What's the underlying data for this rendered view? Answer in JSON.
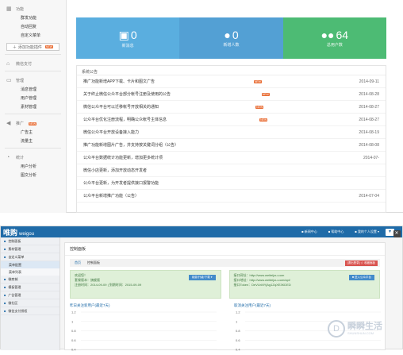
{
  "top_sidebar": {
    "sections": [
      {
        "icon": "grid-icon",
        "label": "功能",
        "items": [
          "群发功能",
          "自动回复",
          "自定义菜单"
        ]
      },
      {
        "add_label": "添加功能插件",
        "badge": "NEW"
      },
      {
        "icon": "store-icon",
        "label": "微信支付",
        "items": []
      },
      {
        "icon": "inbox-icon",
        "label": "管理",
        "items": [
          "消息管理",
          "用户管理",
          "素材管理"
        ]
      },
      {
        "icon": "megaphone-icon",
        "label": "推广",
        "badge": "NEW",
        "items": [
          "广告主",
          "流量主"
        ]
      },
      {
        "icon": "chart-icon",
        "label": "统计",
        "items": [
          "用户分析",
          "图文分析"
        ]
      }
    ]
  },
  "stats": [
    {
      "icon": "message-icon",
      "value": "0",
      "label": "新消息",
      "color": "#5aaedf"
    },
    {
      "icon": "user-icon",
      "value": "0",
      "label": "新增人数",
      "color": "#53a0d4"
    },
    {
      "icon": "users-icon",
      "value": "64",
      "label": "总用户数",
      "color": "#4dbb74"
    }
  ],
  "announcements": {
    "title": "系统公告",
    "rows": [
      {
        "text": "推广功能新增APP下载、卡片和图文广告",
        "new": true,
        "date": "2014-09-11"
      },
      {
        "text": "关于终止微信公众平台部分帐号注册及使用的公告",
        "new": true,
        "date": "2014-08-28"
      },
      {
        "text": "微信公众平台可以迁移帐号开放相关的通知",
        "new": true,
        "date": "2014-08-27"
      },
      {
        "text": "公众平台优化注册流程，明确公众帐号主体信息",
        "new": true,
        "date": "2014-08-27"
      },
      {
        "text": "微信公众平台开放设备接入能力",
        "new": false,
        "date": "2014-08-19"
      },
      {
        "text": "推广功能新增图片广告，并支持按关键词分组（公告）",
        "new": false,
        "date": "2014-08-08"
      },
      {
        "text": "公众平台数据统计功能更新，增加更多统计项",
        "new": false,
        "date": "2014-07-"
      },
      {
        "text": "微信小店更新，添加开放动态开发者",
        "new": false,
        "date": ""
      },
      {
        "text": "公众平台更新，为开发者提供接口报警功能",
        "new": false,
        "date": ""
      },
      {
        "text": "公众平台新增推广功能（公告）",
        "new": false,
        "date": "2014-07-04"
      }
    ]
  },
  "bottom": {
    "logo": "唯购",
    "logo_sub": "weigou",
    "header_links": [
      "■ 新闻中心",
      "■ 帮助中心",
      "■ 我的个人设置 ▾"
    ],
    "sidebar": [
      {
        "label": "控制面板",
        "type": "item"
      },
      {
        "label": "素材管理",
        "type": "item"
      },
      {
        "label": "自定义菜单",
        "type": "item"
      },
      {
        "label": "菜单配置",
        "type": "sub",
        "active": true
      },
      {
        "label": "菜单列表",
        "type": "sub",
        "active": false
      },
      {
        "label": "微商城",
        "type": "item"
      },
      {
        "label": "模板管理",
        "type": "item"
      },
      {
        "label": "广告管理",
        "type": "item"
      },
      {
        "label": "微社区",
        "type": "item"
      },
      {
        "label": "微信支付授权",
        "type": "item"
      }
    ],
    "page_title": "控制面板",
    "breadcrumb": [
      "首页",
      "控制面板"
    ],
    "quit_button": "[退出登录]  ☆ 收藏面板",
    "account_left": [
      "欢迎您！",
      "套餐版本：旗舰版",
      "注册时间：2014-09-09 | 到期时间：2015-09-09"
    ],
    "account_left_button": "续费/升级/下载 ▾",
    "account_right": [
      "接口网址：http://www.weiteijou.com",
      "接口地址：http://www.weiteijou.com/api/",
      "接口Token：DeVLhMYjAg1ZqXE3KDED"
    ],
    "account_right_button": "■ 进入公众平台"
  },
  "chart_data": [
    {
      "type": "line",
      "title": "昨日关注新用户(最近7天)",
      "ylim": [
        0.4,
        1.2
      ],
      "yticks": [
        "1.2",
        "1",
        "0.8",
        "0.6",
        "0.4"
      ],
      "series": []
    },
    {
      "type": "line",
      "title": "取消关注用户(最近7天)",
      "ylim": [
        0.4,
        1.2
      ],
      "yticks": [
        "1.2",
        "1",
        "0.8",
        "0.6",
        "0.4"
      ],
      "series": []
    }
  ],
  "watermark": {
    "title": "瞬瞬生活",
    "url": "SHUNSHUN.COM"
  }
}
